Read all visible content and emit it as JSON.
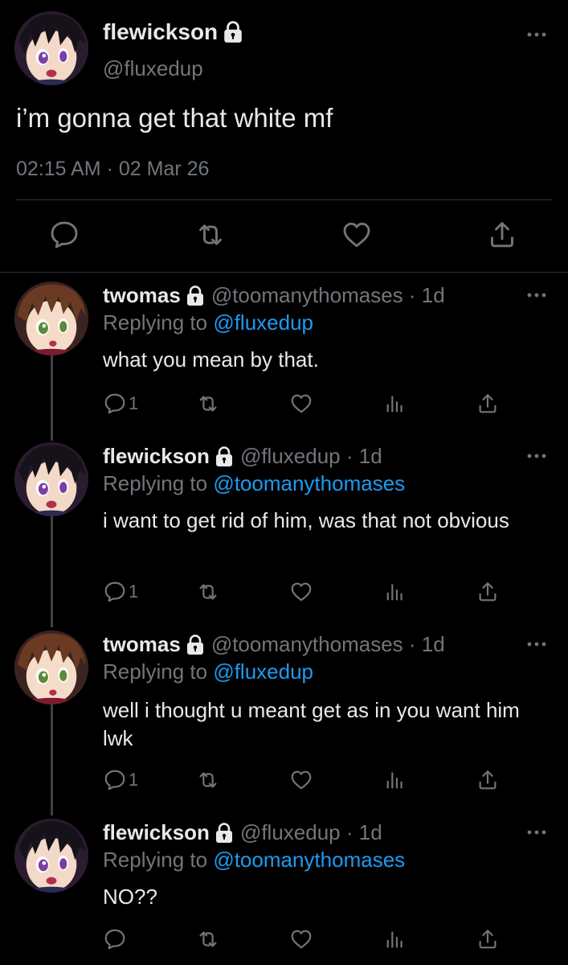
{
  "main_tweet": {
    "display_name": "flewickson",
    "handle": "@fluxedup",
    "text": "i’m gonna get that white mf",
    "timestamp": "02:15 AM · 02 Mar 26"
  },
  "replies": [
    {
      "display_name": "twomas",
      "handle_time": "@toomanythomases · 1d",
      "replying_prefix": "Replying to ",
      "replying_to": "@fluxedup",
      "text": "what you mean by that.",
      "reply_count": "1"
    },
    {
      "display_name": "flewickson",
      "handle_time": "@fluxedup · 1d",
      "replying_prefix": "Replying to ",
      "replying_to": "@toomanythomases",
      "text": "i want to get rid of him, was that not obvious",
      "reply_count": "1"
    },
    {
      "display_name": "twomas",
      "handle_time": "@toomanythomases · 1d",
      "replying_prefix": "Replying to ",
      "replying_to": "@fluxedup",
      "text": "well i thought u meant get as in you want him lwk",
      "reply_count": "1"
    },
    {
      "display_name": "flewickson",
      "handle_time": "@fluxedup · 1d",
      "replying_prefix": "Replying to ",
      "replying_to": "@toomanythomases",
      "text": "NO??",
      "reply_count": ""
    }
  ],
  "colors": {
    "background": "#000000",
    "text": "#e7e9ea",
    "secondary": "#71767b",
    "mention": "#1d9bf0",
    "divider": "#2f3336"
  },
  "icons": [
    "lock-icon",
    "more-icon",
    "reply-icon",
    "retweet-icon",
    "like-icon",
    "views-icon",
    "share-icon"
  ]
}
